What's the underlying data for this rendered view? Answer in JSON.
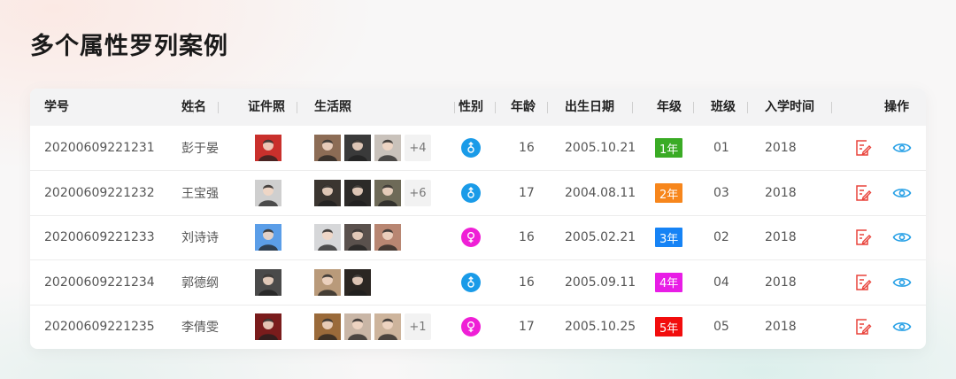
{
  "title": "多个属性罗列案例",
  "columns": {
    "student_id": "学号",
    "name": "姓名",
    "id_photo": "证件照",
    "life_photos": "生活照",
    "gender": "性别",
    "age": "年龄",
    "birthdate": "出生日期",
    "grade": "年级",
    "class": "班级",
    "enroll": "入学时间",
    "actions": "操作"
  },
  "colors": {
    "male": "#1a9be8",
    "female": "#ef1fd6",
    "grade1": "#3aab25",
    "grade2": "#f7861c",
    "grade3": "#1683f5",
    "grade4": "#e81de6",
    "grade5": "#f20d0d",
    "edit_icon": "#e9433b",
    "view_icon": "#27a0e6"
  },
  "rows": [
    {
      "student_id": "20200609221231",
      "name": "彭于晏",
      "gender": "male",
      "age": "16",
      "birthdate": "2005.10.21",
      "grade": "1年",
      "grade_color": "#3aab25",
      "class": "01",
      "enroll": "2018",
      "life_count": 3,
      "more": "+4",
      "id_bg": "#c9302c",
      "life_bgs": [
        "#8c6c55",
        "#3a3a3a",
        "#c9c2bb"
      ]
    },
    {
      "student_id": "20200609221232",
      "name": "王宝强",
      "gender": "male",
      "age": "17",
      "birthdate": "2004.08.11",
      "grade": "2年",
      "grade_color": "#f7861c",
      "class": "03",
      "enroll": "2018",
      "life_count": 3,
      "more": "+6",
      "id_bg": "#cfcfcf",
      "life_bgs": [
        "#3b3530",
        "#2c2a28",
        "#6e6a58"
      ]
    },
    {
      "student_id": "20200609221233",
      "name": "刘诗诗",
      "gender": "female",
      "age": "16",
      "birthdate": "2005.02.21",
      "grade": "3年",
      "grade_color": "#1683f5",
      "class": "02",
      "enroll": "2018",
      "life_count": 3,
      "more": "",
      "id_bg": "#5b9ee8",
      "life_bgs": [
        "#d6d7d9",
        "#5a514d",
        "#b88672"
      ]
    },
    {
      "student_id": "20200609221234",
      "name": "郭德纲",
      "gender": "male",
      "age": "16",
      "birthdate": "2005.09.11",
      "grade": "4年",
      "grade_color": "#e81de6",
      "class": "04",
      "enroll": "2018",
      "life_count": 2,
      "more": "",
      "id_bg": "#4a4a4a",
      "life_bgs": [
        "#b99a7a",
        "#2b2622"
      ]
    },
    {
      "student_id": "20200609221235",
      "name": "李倩雯",
      "gender": "female",
      "age": "17",
      "birthdate": "2005.10.25",
      "grade": "5年",
      "grade_color": "#f20d0d",
      "class": "05",
      "enroll": "2018",
      "life_count": 3,
      "more": "+1",
      "id_bg": "#7a1c1c",
      "life_bgs": [
        "#9a6a3a",
        "#c9b6a6",
        "#cdb49c"
      ]
    }
  ]
}
